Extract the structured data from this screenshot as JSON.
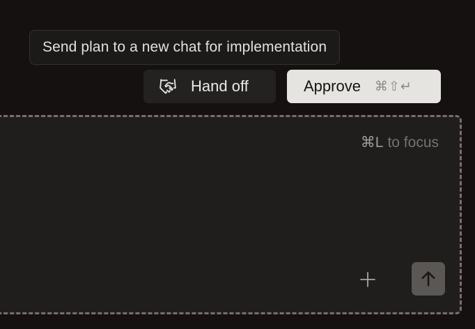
{
  "tooltip": {
    "text": "Send plan to a new chat for implementation"
  },
  "actions": {
    "handoff_label": "Hand off",
    "handoff_icon": "handshake-icon",
    "approve_label": "Approve",
    "approve_shortcut": "⌘⇧↵"
  },
  "composer": {
    "focus_key": "⌘L",
    "focus_text": "to focus",
    "add_icon": "plus-icon",
    "send_icon": "arrow-up-icon"
  },
  "colors": {
    "background": "#141110",
    "approve_bg": "#e6e4e1",
    "handoff_bg": "#242221",
    "composer_border": "#7c6d6d",
    "send_bg": "#5a5755"
  }
}
